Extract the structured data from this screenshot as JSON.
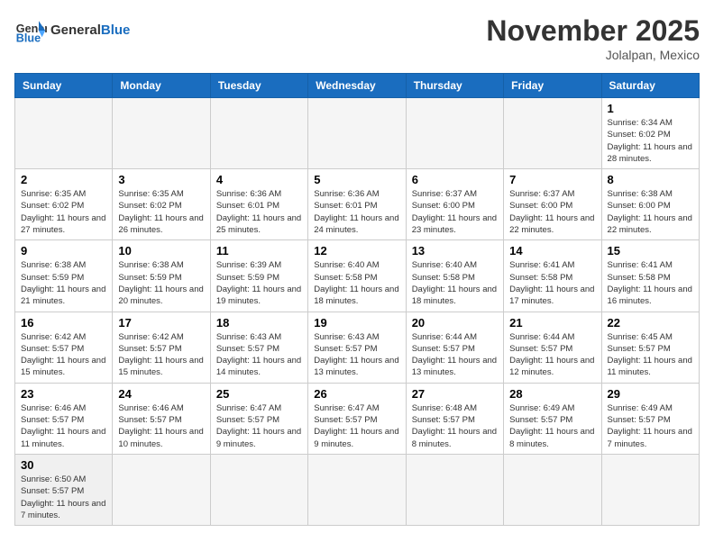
{
  "header": {
    "logo_general": "General",
    "logo_blue": "Blue",
    "month_title": "November 2025",
    "location": "Jolalpan, Mexico"
  },
  "days_of_week": [
    "Sunday",
    "Monday",
    "Tuesday",
    "Wednesday",
    "Thursday",
    "Friday",
    "Saturday"
  ],
  "weeks": [
    [
      {
        "day": "",
        "info": ""
      },
      {
        "day": "",
        "info": ""
      },
      {
        "day": "",
        "info": ""
      },
      {
        "day": "",
        "info": ""
      },
      {
        "day": "",
        "info": ""
      },
      {
        "day": "",
        "info": ""
      },
      {
        "day": "1",
        "info": "Sunrise: 6:34 AM\nSunset: 6:02 PM\nDaylight: 11 hours\nand 28 minutes."
      }
    ],
    [
      {
        "day": "2",
        "info": "Sunrise: 6:35 AM\nSunset: 6:02 PM\nDaylight: 11 hours\nand 27 minutes."
      },
      {
        "day": "3",
        "info": "Sunrise: 6:35 AM\nSunset: 6:02 PM\nDaylight: 11 hours\nand 26 minutes."
      },
      {
        "day": "4",
        "info": "Sunrise: 6:36 AM\nSunset: 6:01 PM\nDaylight: 11 hours\nand 25 minutes."
      },
      {
        "day": "5",
        "info": "Sunrise: 6:36 AM\nSunset: 6:01 PM\nDaylight: 11 hours\nand 24 minutes."
      },
      {
        "day": "6",
        "info": "Sunrise: 6:37 AM\nSunset: 6:00 PM\nDaylight: 11 hours\nand 23 minutes."
      },
      {
        "day": "7",
        "info": "Sunrise: 6:37 AM\nSunset: 6:00 PM\nDaylight: 11 hours\nand 22 minutes."
      },
      {
        "day": "8",
        "info": "Sunrise: 6:38 AM\nSunset: 6:00 PM\nDaylight: 11 hours\nand 22 minutes."
      }
    ],
    [
      {
        "day": "9",
        "info": "Sunrise: 6:38 AM\nSunset: 5:59 PM\nDaylight: 11 hours\nand 21 minutes."
      },
      {
        "day": "10",
        "info": "Sunrise: 6:38 AM\nSunset: 5:59 PM\nDaylight: 11 hours\nand 20 minutes."
      },
      {
        "day": "11",
        "info": "Sunrise: 6:39 AM\nSunset: 5:59 PM\nDaylight: 11 hours\nand 19 minutes."
      },
      {
        "day": "12",
        "info": "Sunrise: 6:40 AM\nSunset: 5:58 PM\nDaylight: 11 hours\nand 18 minutes."
      },
      {
        "day": "13",
        "info": "Sunrise: 6:40 AM\nSunset: 5:58 PM\nDaylight: 11 hours\nand 18 minutes."
      },
      {
        "day": "14",
        "info": "Sunrise: 6:41 AM\nSunset: 5:58 PM\nDaylight: 11 hours\nand 17 minutes."
      },
      {
        "day": "15",
        "info": "Sunrise: 6:41 AM\nSunset: 5:58 PM\nDaylight: 11 hours\nand 16 minutes."
      }
    ],
    [
      {
        "day": "16",
        "info": "Sunrise: 6:42 AM\nSunset: 5:57 PM\nDaylight: 11 hours\nand 15 minutes."
      },
      {
        "day": "17",
        "info": "Sunrise: 6:42 AM\nSunset: 5:57 PM\nDaylight: 11 hours\nand 15 minutes."
      },
      {
        "day": "18",
        "info": "Sunrise: 6:43 AM\nSunset: 5:57 PM\nDaylight: 11 hours\nand 14 minutes."
      },
      {
        "day": "19",
        "info": "Sunrise: 6:43 AM\nSunset: 5:57 PM\nDaylight: 11 hours\nand 13 minutes."
      },
      {
        "day": "20",
        "info": "Sunrise: 6:44 AM\nSunset: 5:57 PM\nDaylight: 11 hours\nand 13 minutes."
      },
      {
        "day": "21",
        "info": "Sunrise: 6:44 AM\nSunset: 5:57 PM\nDaylight: 11 hours\nand 12 minutes."
      },
      {
        "day": "22",
        "info": "Sunrise: 6:45 AM\nSunset: 5:57 PM\nDaylight: 11 hours\nand 11 minutes."
      }
    ],
    [
      {
        "day": "23",
        "info": "Sunrise: 6:46 AM\nSunset: 5:57 PM\nDaylight: 11 hours\nand 11 minutes."
      },
      {
        "day": "24",
        "info": "Sunrise: 6:46 AM\nSunset: 5:57 PM\nDaylight: 11 hours\nand 10 minutes."
      },
      {
        "day": "25",
        "info": "Sunrise: 6:47 AM\nSunset: 5:57 PM\nDaylight: 11 hours\nand 9 minutes."
      },
      {
        "day": "26",
        "info": "Sunrise: 6:47 AM\nSunset: 5:57 PM\nDaylight: 11 hours\nand 9 minutes."
      },
      {
        "day": "27",
        "info": "Sunrise: 6:48 AM\nSunset: 5:57 PM\nDaylight: 11 hours\nand 8 minutes."
      },
      {
        "day": "28",
        "info": "Sunrise: 6:49 AM\nSunset: 5:57 PM\nDaylight: 11 hours\nand 8 minutes."
      },
      {
        "day": "29",
        "info": "Sunrise: 6:49 AM\nSunset: 5:57 PM\nDaylight: 11 hours\nand 7 minutes."
      }
    ],
    [
      {
        "day": "30",
        "info": "Sunrise: 6:50 AM\nSunset: 5:57 PM\nDaylight: 11 hours\nand 7 minutes."
      },
      {
        "day": "",
        "info": ""
      },
      {
        "day": "",
        "info": ""
      },
      {
        "day": "",
        "info": ""
      },
      {
        "day": "",
        "info": ""
      },
      {
        "day": "",
        "info": ""
      },
      {
        "day": "",
        "info": ""
      }
    ]
  ]
}
